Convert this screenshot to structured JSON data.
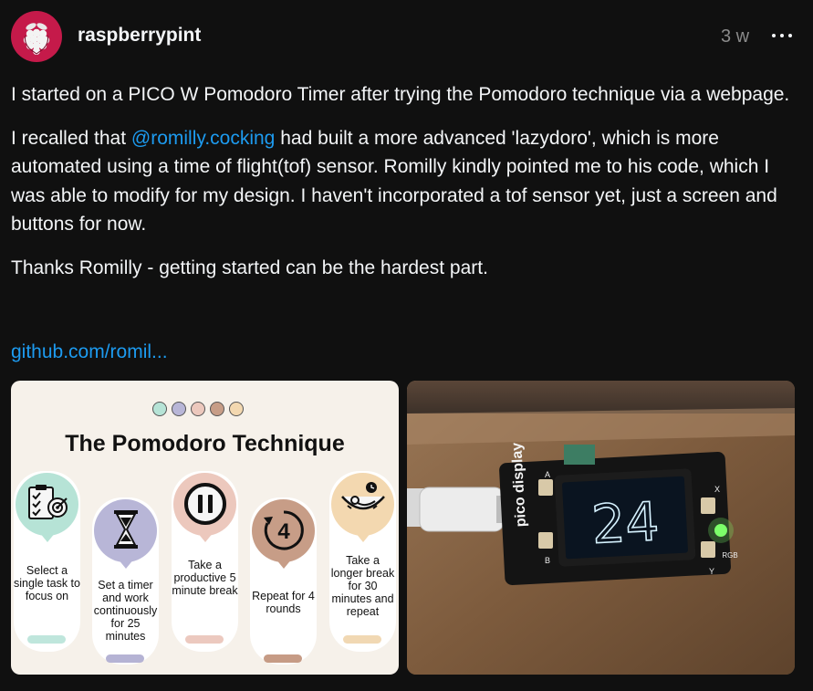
{
  "post": {
    "username": "raspberrypint",
    "time_ago": "3 w",
    "paragraphs": [
      [
        "I started on a PICO W Pomodoro Timer after trying the Pomodoro technique via a webpage."
      ],
      [
        "I recalled that ",
        "@romilly.cocking",
        " had built a more advanced 'lazydoro', which is more automated using a time of flight(tof) sensor. Romilly kindly pointed me to his code, which I was able to modify for my design. I haven't incorporated a tof sensor yet, just a screen and buttons for now."
      ],
      [
        "Thanks Romilly - getting started can be the hardest part."
      ]
    ],
    "link_text": "github.com/romil..."
  },
  "infographic": {
    "title": "The Pomodoro Technique",
    "dot_colors": [
      "#b6e3d6",
      "#b8b6d7",
      "#ecc8bd",
      "#c79d87",
      "#f3d8b0"
    ],
    "steps": [
      {
        "text": "Select a single task to focus on",
        "color": "#b6e3d6",
        "bar": "#bfe6dc",
        "icon": "clipboard-target-icon"
      },
      {
        "text": "Set a timer and work continuously for 25 minutes",
        "color": "#b8b6d7",
        "bar": "#b5b3d4",
        "icon": "hourglass-icon"
      },
      {
        "text": "Take a productive 5 minute break",
        "color": "#ecc8bd",
        "bar": "#ecc9bf",
        "icon": "pause-icon"
      },
      {
        "text": "Repeat for 4 rounds",
        "color": "#c79d87",
        "bar": "#c69b85",
        "icon": "repeat-four-icon"
      },
      {
        "text": "Take a longer break for 30 minutes and repeat",
        "color": "#f3d8b0",
        "bar": "#f1d8b3",
        "icon": "hammock-clock-icon"
      }
    ]
  },
  "device_photo": {
    "display_number": "24",
    "board_label": "pico display",
    "button_labels": [
      "A",
      "B",
      "X",
      "Y",
      "RGB"
    ]
  }
}
